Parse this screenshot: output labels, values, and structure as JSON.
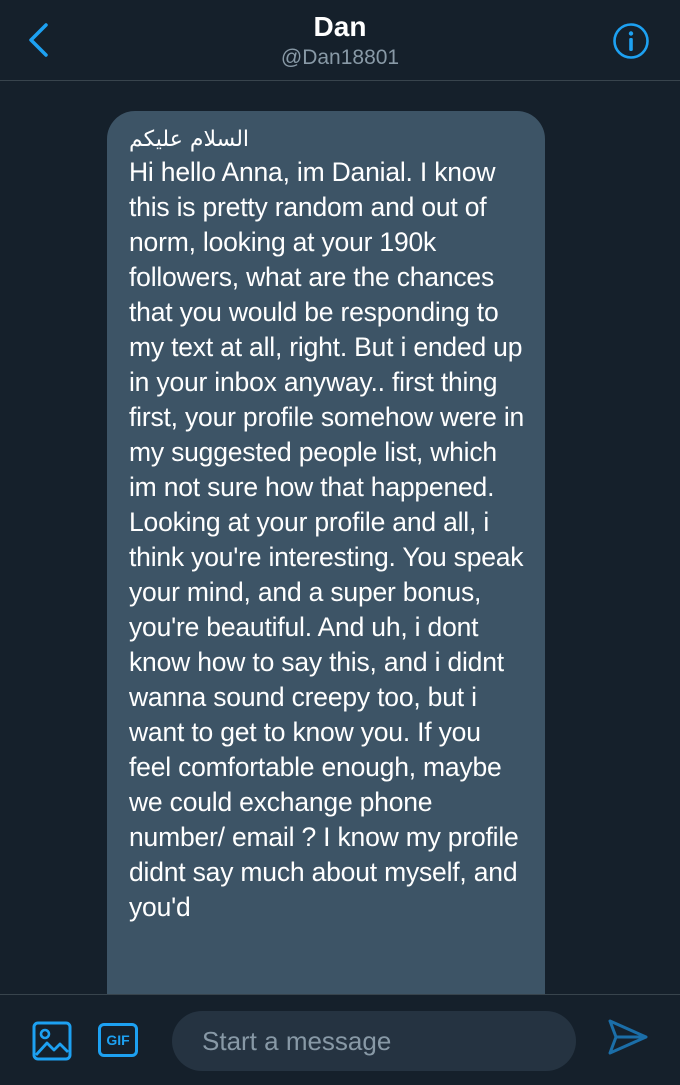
{
  "header": {
    "title": "Dan",
    "handle": "@Dan18801",
    "back_icon": "chevron-left-icon",
    "info_icon": "info-icon"
  },
  "message": {
    "greeting": "السلام عليكم",
    "text": "Hi hello Anna, im Danial. I know this is pretty random and out of norm, looking at your 190k followers, what are the chances that you would be responding to my text at all, right. But i ended up in your inbox anyway.. first thing first, your profile somehow were in my suggested people list, which im not sure how that happened. Looking at your profile and all, i think you're interesting. You speak your mind, and a super bonus, you're beautiful. And uh, i dont know how to say this, and i didnt wanna sound creepy too, but i want to get to know you. If you feel comfortable enough, maybe we could exchange phone number/ email ? I know my profile didnt say much about myself, and you'd"
  },
  "composer": {
    "gif_label": "GIF",
    "placeholder": "Start a message",
    "media_icon": "image-icon",
    "send_icon": "send-icon"
  },
  "colors": {
    "background": "#15202b",
    "bubble": "#3d5466",
    "accent": "#1da1f2",
    "secondary_text": "#8899a6"
  }
}
